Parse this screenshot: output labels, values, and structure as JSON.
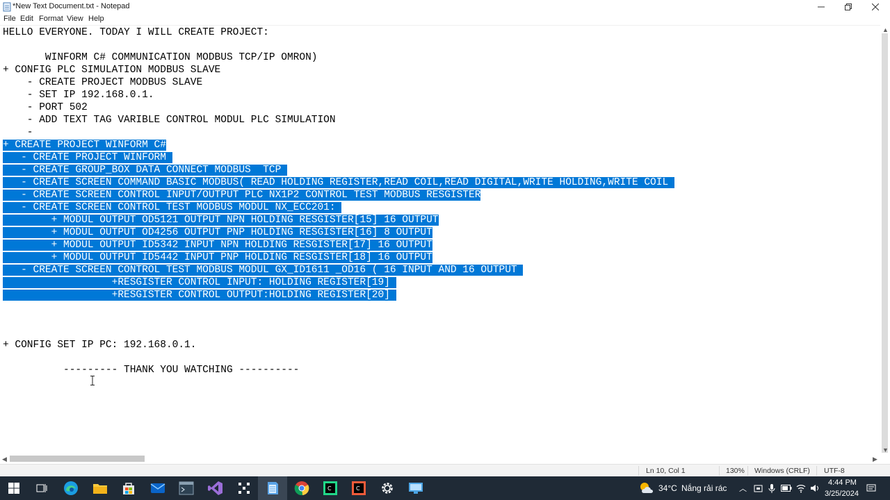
{
  "window": {
    "title": "*New Text Document.txt - Notepad",
    "minimize_glyph": "—",
    "maximize_glyph": "❐",
    "close_glyph": "✕"
  },
  "menu": [
    "File",
    "Edit",
    "Format",
    "View",
    "Help"
  ],
  "editor": {
    "lines": [
      {
        "text": "HELLO EVERYONE. TODAY I WILL CREATE PROJECT:",
        "selected": false
      },
      {
        "text": "",
        "selected": false
      },
      {
        "text": "       WINFORM C# COMMUNICATION MODBUS TCP/IP OMRON)",
        "selected": false
      },
      {
        "text": "+ CONFIG PLC SIMULATION MODBUS SLAVE",
        "selected": false
      },
      {
        "text": "    - CREATE PROJECT MODBUS SLAVE",
        "selected": false
      },
      {
        "text": "    - SET IP 192.168.0.1.",
        "selected": false
      },
      {
        "text": "    - PORT 502",
        "selected": false
      },
      {
        "text": "    - ADD TEXT TAG VARIBLE CONTROL MODUL PLC SIMULATION",
        "selected": false
      },
      {
        "text": "    -",
        "selected": false
      },
      {
        "text": "+ CREATE PROJECT WINFORM C#",
        "selected": true
      },
      {
        "text": "   - CREATE PROJECT WINFORM ",
        "selected": true
      },
      {
        "text": "   - CREATE GROUP_BOX DATA CONNECT MODBUS  TCP ",
        "selected": true
      },
      {
        "text": "   - CREATE SCREEN COMMAND BASIC MODBUS( READ HOLDING REGISTER,READ COIL,READ DIGITAL,WRITE HOLDING,WRITE COIL ",
        "selected": true
      },
      {
        "text": "   - CREATE SCREEN CONTROL INPUT/OUTPUT PLC NX1P2 CONTROL TEST MODBUS RESGISTER",
        "selected": true
      },
      {
        "text": "   - CREATE SCREEN CONTROL TEST MODBUS MODUL NX_ECC201: ",
        "selected": true
      },
      {
        "text": "        + MODUL OUTPUT OD5121 OUTPUT NPN HOLDING RESGISTER[15] 16 OUTPUT",
        "selected": true
      },
      {
        "text": "        + MODUL OUTPUT OD4256 OUTPUT PNP HOLDING RESGISTER[16] 8 OUTPUT",
        "selected": true
      },
      {
        "text": "        + MODUL OUTPUT ID5342 INPUT NPN HOLDING RESGISTER[17] 16 OUTPUT",
        "selected": true
      },
      {
        "text": "        + MODUL OUTPUT ID5442 INPUT PNP HOLDING RESGISTER[18] 16 OUTPUT",
        "selected": true
      },
      {
        "text": "   - CREATE SCREEN CONTROL TEST MODBUS MODUL GX_ID1611 _OD16 ( 16 INPUT AND 16 OUTPUT ",
        "selected": true
      },
      {
        "text": "                  +RESGISTER CONTROL INPUT: HOLDING REGISTER[19] ",
        "selected": true
      },
      {
        "text": "                  +RESGISTER CONTROL OUTPUT:HOLDING REGISTER[20] ",
        "selected": true
      },
      {
        "text": "",
        "selected": false
      },
      {
        "text": "",
        "selected": false
      },
      {
        "text": "",
        "selected": false
      },
      {
        "text": "+ CONFIG SET IP PC: 192.168.0.1.",
        "selected": false
      },
      {
        "text": "",
        "selected": false
      },
      {
        "text": "          --------- THANK YOU WATCHING ----------",
        "selected": false
      }
    ]
  },
  "status": {
    "position": "Ln 10, Col 1",
    "zoom": "130%",
    "line_ending": "Windows (CRLF)",
    "encoding": "UTF-8"
  },
  "taskbar": {
    "icons": [
      "windows-start-icon",
      "task-view-icon",
      "edge-icon",
      "file-explorer-icon",
      "microsoft-store-icon",
      "mail-icon",
      "terminal-app-icon",
      "visual-studio-icon",
      "widgets-app-icon",
      "notepad-icon",
      "chrome-icon",
      "clion-icon",
      "ide-app-icon",
      "settings-icon",
      "remote-desktop-icon"
    ],
    "weather": {
      "temp": "34°C",
      "desc": "Nắng rải rác"
    },
    "time": "4:44 PM",
    "date": "3/25/2024"
  }
}
